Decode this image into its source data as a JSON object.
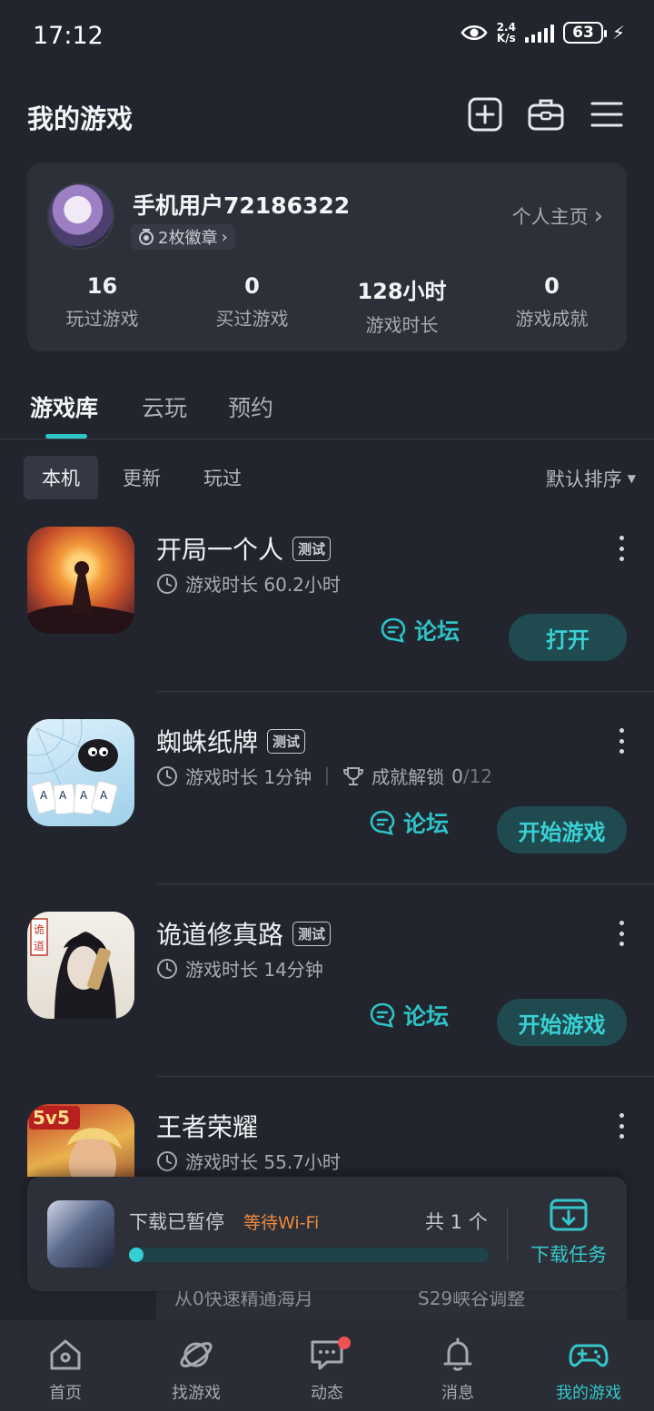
{
  "status_bar": {
    "time": "17:12",
    "net_speed_value": "2.4",
    "net_speed_unit": "K/s",
    "battery": "63"
  },
  "header": {
    "title": "我的游戏"
  },
  "profile": {
    "username": "手机用户72186322",
    "badges": "2枚徽章",
    "homepage_link": "个人主页",
    "stats": [
      {
        "value": "16",
        "label": "玩过游戏"
      },
      {
        "value": "0",
        "label": "买过游戏"
      },
      {
        "value": "128小时",
        "label": "游戏时长"
      },
      {
        "value": "0",
        "label": "游戏成就"
      }
    ]
  },
  "tabs": [
    {
      "label": "游戏库",
      "active": true
    },
    {
      "label": "云玩",
      "active": false
    },
    {
      "label": "预约",
      "active": false
    }
  ],
  "filters": [
    {
      "label": "本机",
      "active": true
    },
    {
      "label": "更新",
      "active": false
    },
    {
      "label": "玩过",
      "active": false
    }
  ],
  "sort_label": "默认排序",
  "games": [
    {
      "name": "开局一个人",
      "tag": "测试",
      "playtime": "游戏时长 60.2小时",
      "forum": "论坛",
      "action": "打开"
    },
    {
      "name": "蜘蛛纸牌",
      "tag": "测试",
      "playtime": "游戏时长 1分钟",
      "achievement_label": "成就解锁",
      "achievement_done": "0",
      "achievement_total": "/12",
      "forum": "论坛",
      "action": "开始游戏"
    },
    {
      "name": "诡道修真路",
      "tag": "测试",
      "playtime": "游戏时长 14分钟",
      "forum": "论坛",
      "action": "开始游戏"
    },
    {
      "name": "王者荣耀",
      "playtime": "游戏时长 55.7小时"
    }
  ],
  "obscured_strip": {
    "left_text": "从0快速精通海月",
    "right_text": "S29峡谷调整"
  },
  "download": {
    "status": "下载已暂停",
    "waiting": "等待Wi-Fi",
    "count": "共 1 个",
    "progress": 0.03,
    "task_label": "下载任务"
  },
  "nav": [
    {
      "label": "首页",
      "icon": "home-icon"
    },
    {
      "label": "找游戏",
      "icon": "planet-icon"
    },
    {
      "label": "动态",
      "icon": "chat-icon"
    },
    {
      "label": "消息",
      "icon": "bell-icon"
    },
    {
      "label": "我的游戏",
      "icon": "gamepad-icon",
      "active": true
    }
  ],
  "colors": {
    "accent": "#34c7cb",
    "background": "#22252d",
    "card": "#2c3039",
    "warning": "#f08a3c"
  }
}
